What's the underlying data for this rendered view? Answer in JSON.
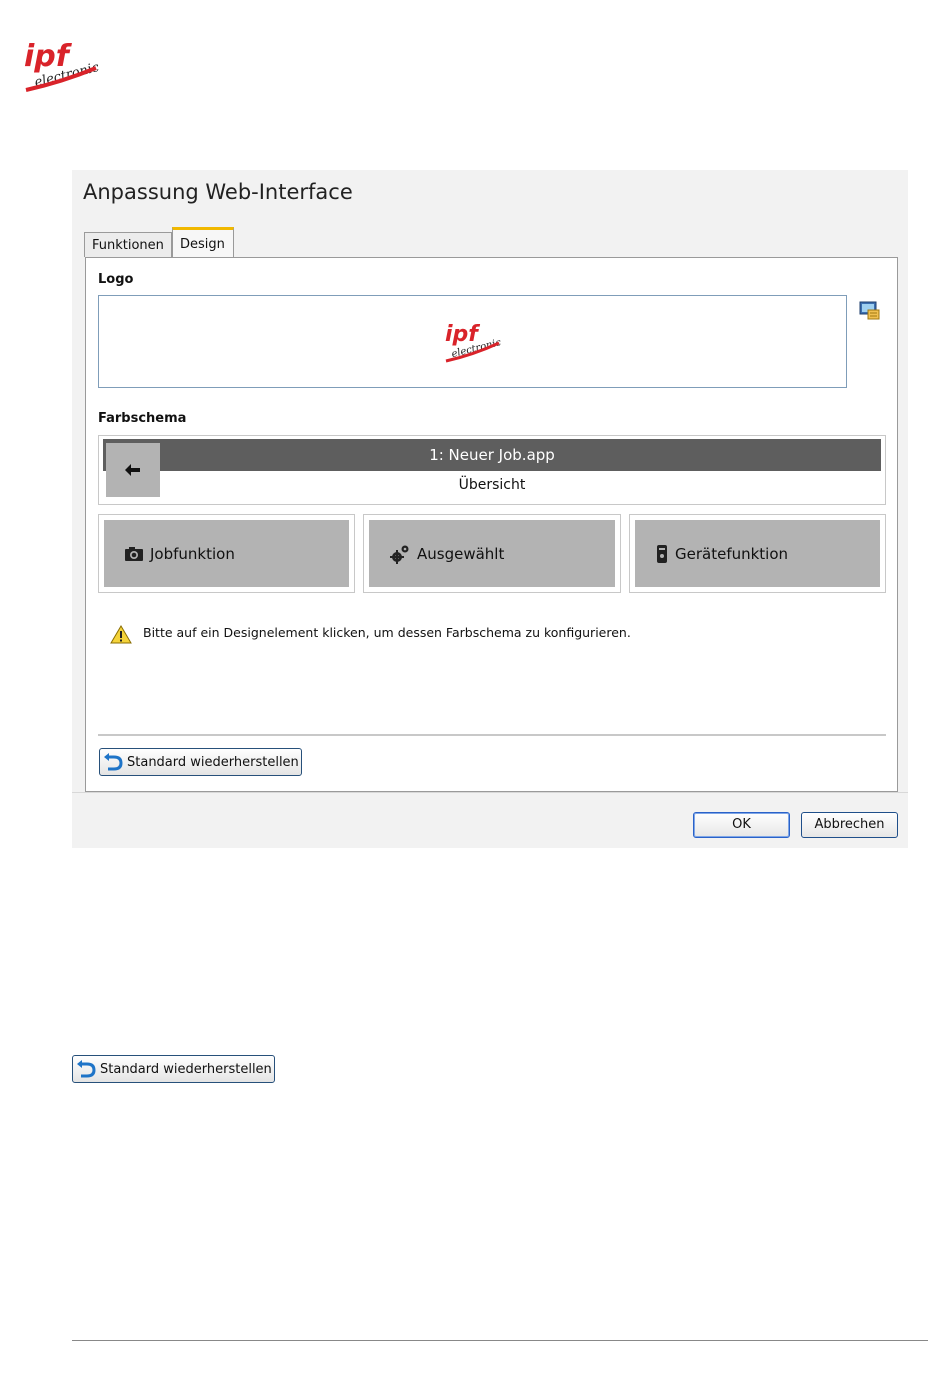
{
  "brand": {
    "logo_text": "ipf",
    "logo_subtext": "electronic",
    "color": "#d9232a"
  },
  "dialog": {
    "title": "Anpassung Web-Interface",
    "tabs": [
      {
        "label": "Funktionen",
        "active": false
      },
      {
        "label": "Design",
        "active": true
      }
    ],
    "logo_section": {
      "label": "Logo",
      "picker_icon": "image-picker-icon"
    },
    "color_scheme": {
      "label": "Farbschema",
      "header_title": "1: Neuer Job.app",
      "header_subtitle": "Übersicht",
      "back_icon": "arrow-left-icon",
      "header_color": "#5e5e5e",
      "tile_color": "#b3b3b3",
      "tiles": [
        {
          "label": "Jobfunktion",
          "icon": "camera-icon"
        },
        {
          "label": "Ausgewählt",
          "icon": "gears-icon"
        },
        {
          "label": "Gerätefunktion",
          "icon": "device-icon"
        }
      ]
    },
    "hint": {
      "icon": "warning-icon",
      "text": "Bitte auf ein Designelement klicken, um dessen Farbschema zu konfigurieren."
    },
    "restore_label": "Standard wiederherstellen",
    "ok_label": "OK",
    "cancel_label": "Abbrechen"
  },
  "standalone_restore_label": "Standard wiederherstellen"
}
